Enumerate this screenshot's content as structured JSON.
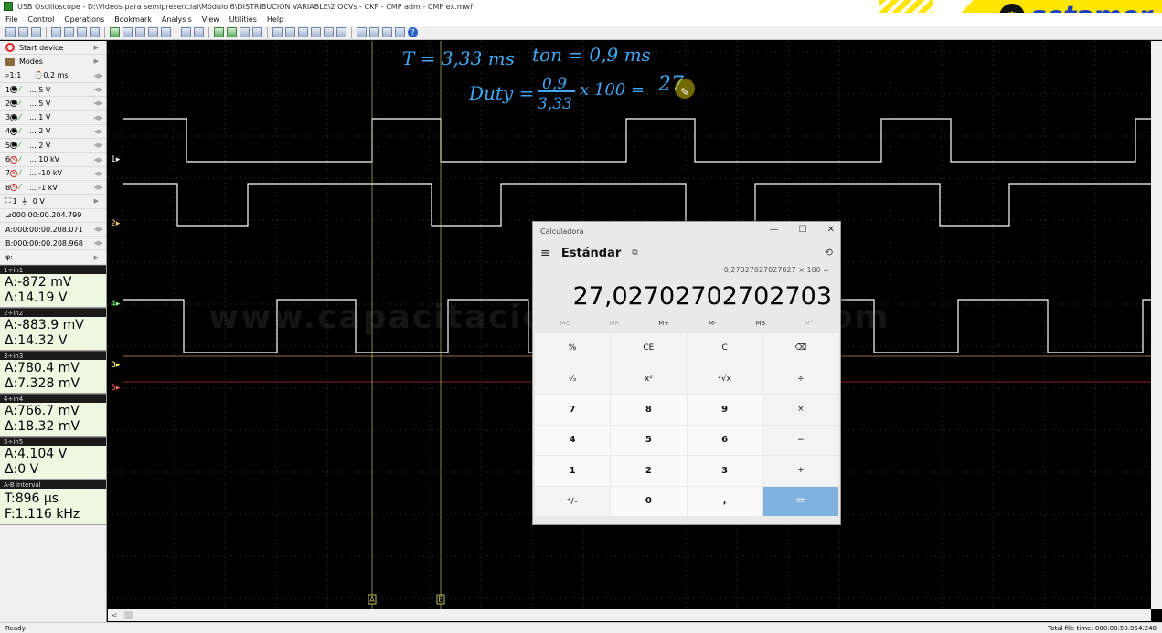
{
  "window": {
    "title": "USB Oscilloscope - D:\\Videos para semipresencial\\Módulo 6\\DISTRIBUCION VARIABLE\\2 OCVs - CKP - CMP adm - CMP ex.mwf"
  },
  "brand": {
    "name": "setamer",
    "icon": "engine-icon",
    "color": "#1a3fbf",
    "accent": "#ffe600"
  },
  "menu": [
    "File",
    "Control",
    "Operations",
    "Bookmark",
    "Analysis",
    "View",
    "Utilities",
    "Help"
  ],
  "left_panel": {
    "start_device": "Start device",
    "modes": "Modes",
    "zoom": "1:1",
    "timebase": "0.2 ms",
    "channels": [
      {
        "num": "1",
        "scale": "... 5 V",
        "enabled": true
      },
      {
        "num": "2",
        "scale": "... 5 V",
        "enabled": true
      },
      {
        "num": "3",
        "scale": "... 1 V",
        "enabled": true
      },
      {
        "num": "4",
        "scale": "... 2 V",
        "enabled": true
      },
      {
        "num": "5",
        "scale": "... 2 V",
        "enabled": true
      },
      {
        "num": "6",
        "scale": "... 10 kV",
        "enabled": false
      },
      {
        "num": "7",
        "scale": "... -10 kV",
        "enabled": false
      },
      {
        "num": "8",
        "scale": "... -1 kV",
        "enabled": false
      }
    ],
    "trigger": {
      "channel": "1",
      "level": "0 V"
    },
    "trigger_time": "000:00:00.204.799",
    "cursor_a": "A:000:00:00.208.071",
    "cursor_b": "B:000:00:00.208.968",
    "phi": "φ:"
  },
  "measurements": [
    {
      "header": "1÷in1",
      "a": "A:-872 mV",
      "delta": "Δ:14.19 V"
    },
    {
      "header": "2÷in2",
      "a": "A:-883.9 mV",
      "delta": "Δ:14.32 V"
    },
    {
      "header": "3÷in3",
      "a": "A:780.4 mV",
      "delta": "Δ:7.328 mV"
    },
    {
      "header": "4÷in4",
      "a": "A:766.7 mV",
      "delta": "Δ:18.32 mV"
    },
    {
      "header": "5÷in5",
      "a": "A:4.104 V",
      "delta": "Δ:0 V"
    }
  ],
  "interval": {
    "header": "A-B interval",
    "t": "T:896 µs",
    "f": "F:1.116 kHz"
  },
  "scope": {
    "channel_markers": [
      "1",
      "2",
      "4",
      "3",
      "5"
    ],
    "channel_colors": {
      "ch1": "#ffffff",
      "ch2": "#ffffff",
      "ch3": "#ffff66",
      "ch4": "#ffffff",
      "ch5": "#ff4444"
    },
    "cursor_labels": [
      "A",
      "B"
    ],
    "watermark": "www.capacitacionautomotriz.com"
  },
  "annotations": {
    "period": "T = 3,33 ms",
    "ton": "ton = 0,9 ms",
    "duty_label": "Duty =",
    "numerator": "0,9",
    "denominator": "3,33",
    "times100": "x 100 =",
    "duty_result": "27"
  },
  "calculator": {
    "title": "Calculadora",
    "mode": "Estándar",
    "expression": "0,27027027027027 × 100 =",
    "result": "27,02702702702703",
    "memory": [
      "MC",
      "MR",
      "M+",
      "M-",
      "MS",
      "M˅"
    ],
    "keys": [
      "%",
      "CE",
      "C",
      "⌫",
      "¹⁄ₓ",
      "x²",
      "²√x",
      "÷",
      "7",
      "8",
      "9",
      "×",
      "4",
      "5",
      "6",
      "−",
      "1",
      "2",
      "3",
      "+",
      "⁺/₋",
      "0",
      ",",
      "="
    ]
  },
  "status": {
    "left": "Ready",
    "right": "Total file time: 000:00:50.954.248"
  }
}
